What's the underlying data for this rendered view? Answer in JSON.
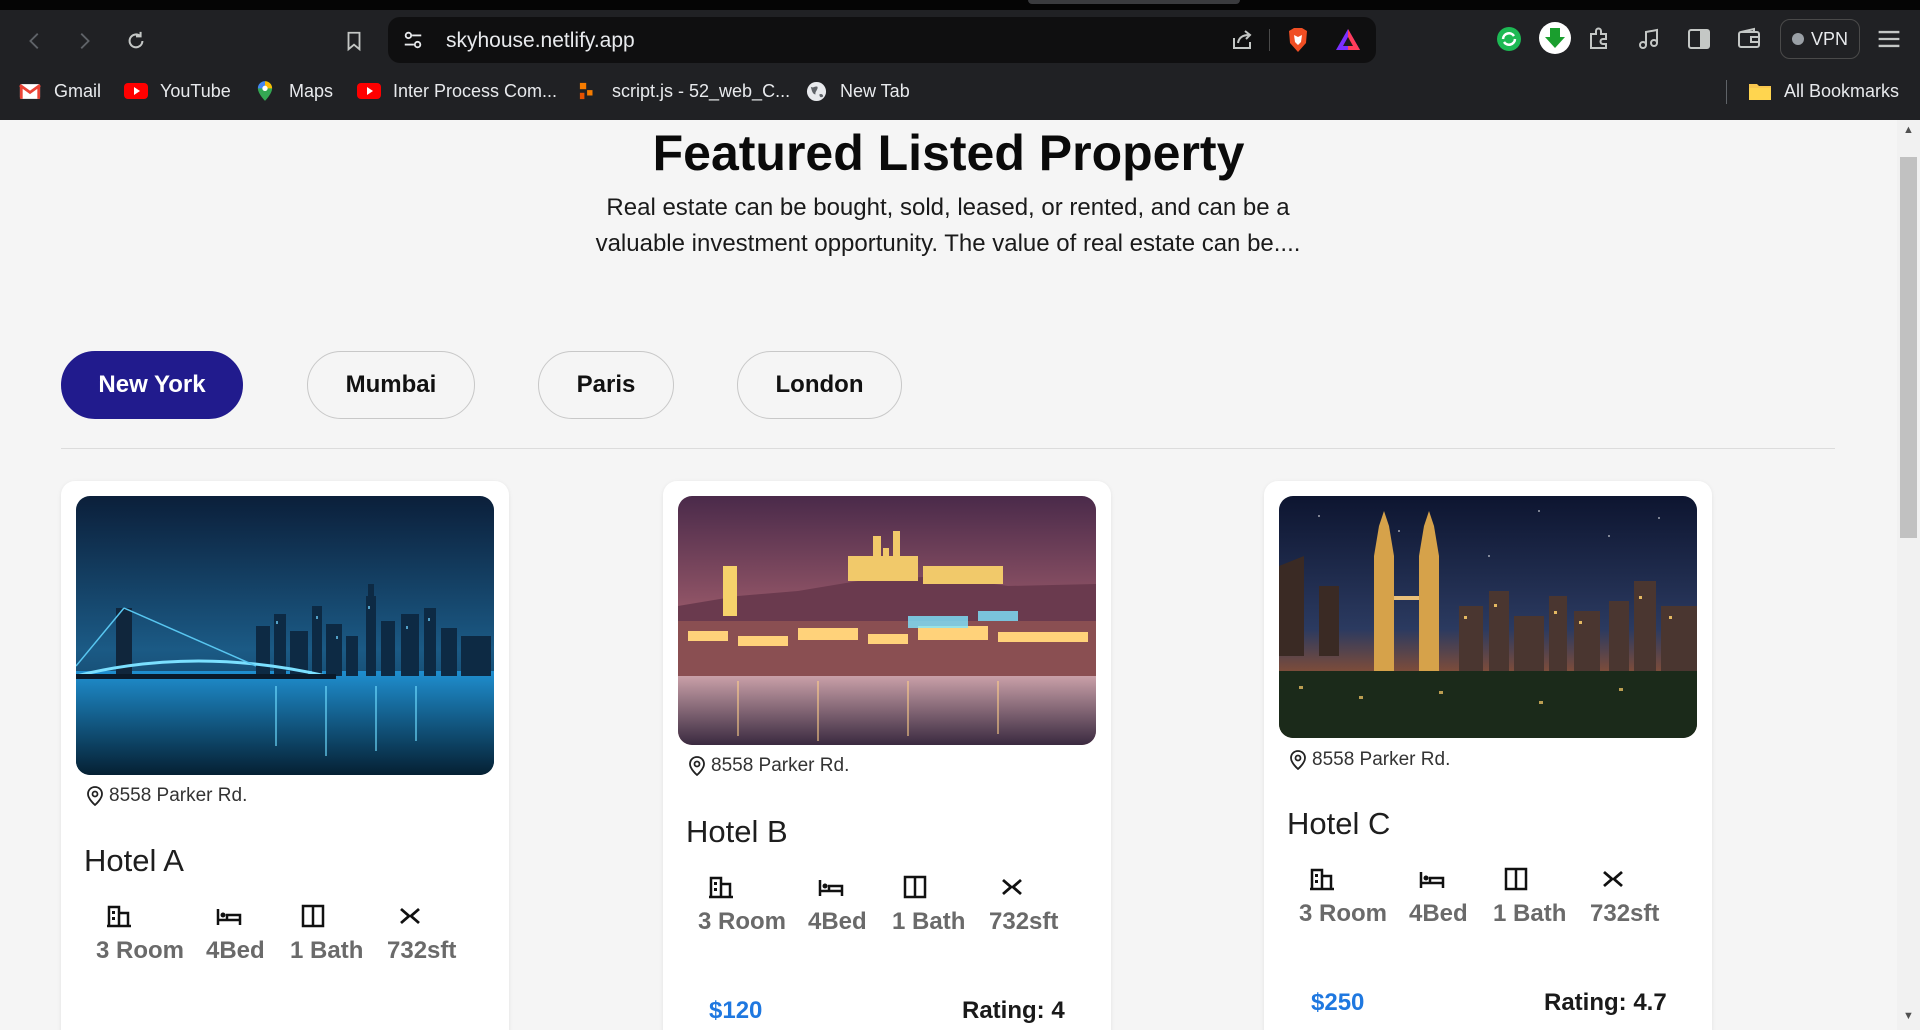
{
  "browser": {
    "url": "skyhouse.netlify.app",
    "vpn_label": "VPN",
    "bookmarks": [
      {
        "label": "Gmail",
        "icon": "gmail-icon"
      },
      {
        "label": "YouTube",
        "icon": "youtube-icon"
      },
      {
        "label": "Maps",
        "icon": "maps-icon"
      },
      {
        "label": "Inter Process Com...",
        "icon": "youtube-icon"
      },
      {
        "label": "script.js - 52_web_C...",
        "icon": "code-icon"
      },
      {
        "label": "New Tab",
        "icon": "globe-icon"
      }
    ],
    "all_bookmarks_label": "All Bookmarks"
  },
  "page": {
    "title": "Featured Listed Property",
    "subtitle": "Real estate can be bought, sold, leased, or rented, and can be a valuable investment opportunity. The value of real estate can be....",
    "tabs": [
      {
        "label": "New York",
        "active": true
      },
      {
        "label": "Mumbai",
        "active": false
      },
      {
        "label": "Paris",
        "active": false
      },
      {
        "label": "London",
        "active": false
      }
    ],
    "listings": [
      {
        "address": "8558 Parker Rd.",
        "name": "Hotel A",
        "rooms": "3 Room",
        "beds": "4Bed",
        "baths": "1 Bath",
        "area": "732sft",
        "price": "",
        "rating": "",
        "photo": "brooklyn-bridge-night-photo"
      },
      {
        "address": "8558 Parker Rd.",
        "name": "Hotel B",
        "rooms": "3 Room",
        "beds": "4Bed",
        "baths": "1 Bath",
        "area": "732sft",
        "price": "$120",
        "rating": "Rating: 4",
        "photo": "prague-castle-night-photo"
      },
      {
        "address": "8558 Parker Rd.",
        "name": "Hotel C",
        "rooms": "3 Room",
        "beds": "4Bed",
        "baths": "1 Bath",
        "area": "732sft",
        "price": "$250",
        "rating": "Rating: 4.7",
        "photo": "kuala-lumpur-towers-night-photo"
      }
    ]
  },
  "colors": {
    "active_tab": "#211b8d",
    "price": "#1f78e0",
    "chrome_bg": "#202124"
  }
}
